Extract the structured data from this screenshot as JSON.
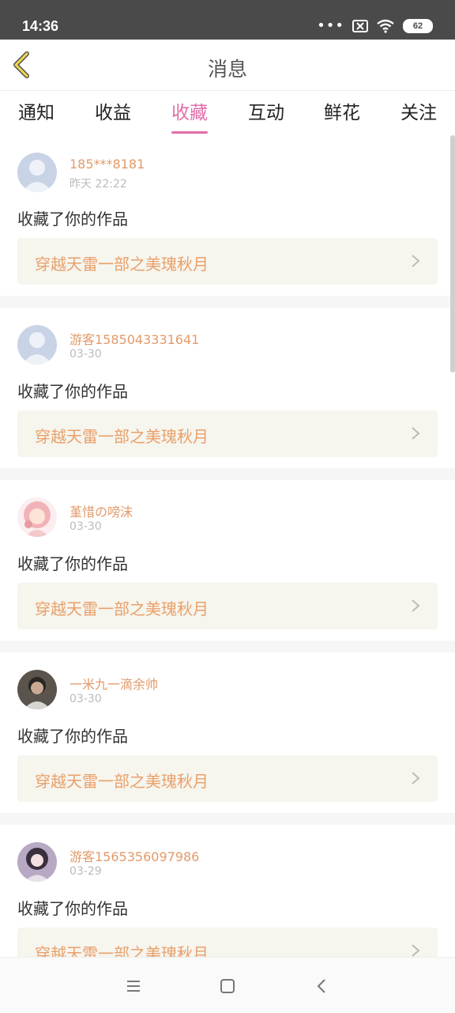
{
  "status_bar": {
    "time": "14:36",
    "battery": "62"
  },
  "header": {
    "title": "消息"
  },
  "tabs": [
    {
      "label": "通知"
    },
    {
      "label": "收益"
    },
    {
      "label": "收藏"
    },
    {
      "label": "互动"
    },
    {
      "label": "鲜花"
    },
    {
      "label": "关注"
    }
  ],
  "active_tab": "收藏",
  "items": [
    {
      "username": "185***8181",
      "time": "昨天 22:22",
      "action": "收藏了你的作品",
      "work_title": "穿越天雷一部之美瑰秋月"
    },
    {
      "username": "游客1585043331641",
      "time": "03-30",
      "action": "收藏了你的作品",
      "work_title": "穿越天雷一部之美瑰秋月"
    },
    {
      "username": "堇惜の嗙沫",
      "time": "03-30",
      "action": "收藏了你的作品",
      "work_title": "穿越天雷一部之美瑰秋月"
    },
    {
      "username": "一米九一滴余帅",
      "time": "03-30",
      "action": "收藏了你的作品",
      "work_title": "穿越天雷一部之美瑰秋月"
    },
    {
      "username": "游客1565356097986",
      "time": "03-29",
      "action": "收藏了你的作品",
      "work_title": "穿越天雷一部之美瑰秋月"
    }
  ],
  "colors": {
    "accent": "#e06fa8",
    "username": "#e39a6a",
    "work_title": "#e9a06a",
    "status_bar": "#4a4a4a"
  }
}
